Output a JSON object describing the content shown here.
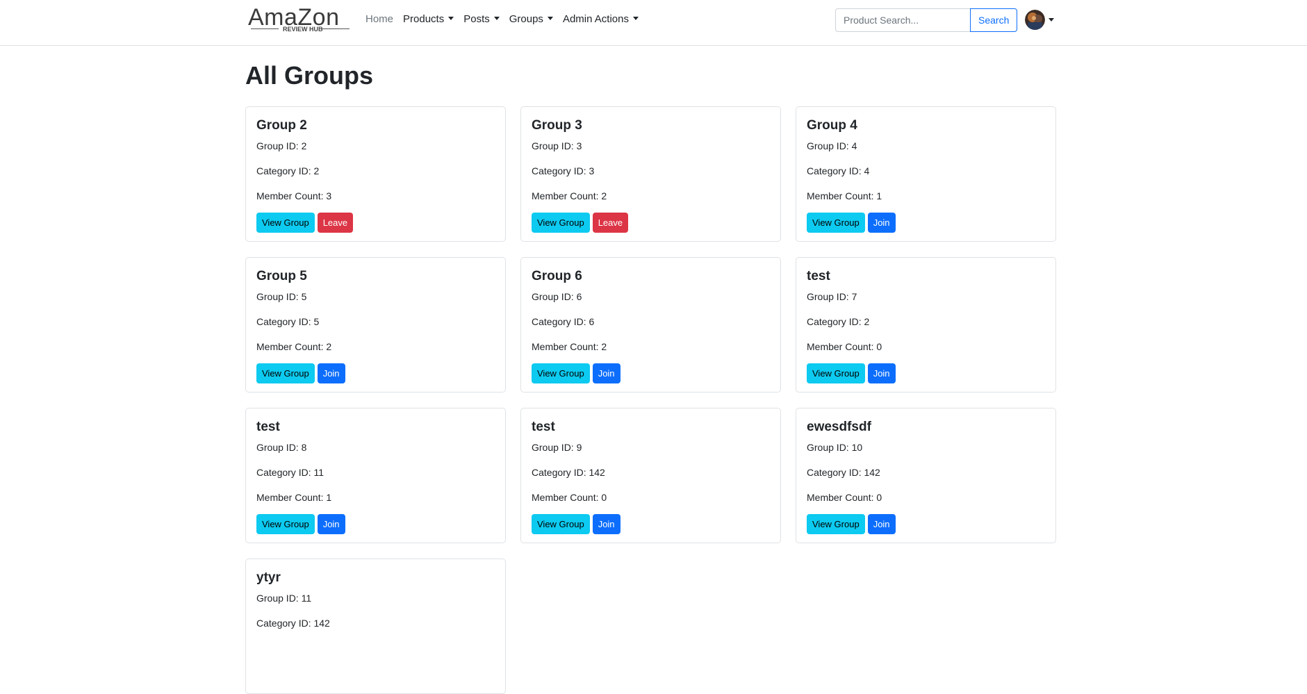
{
  "nav": {
    "logo": {
      "main": "AmaZon",
      "sub": "REVIEW HUB"
    },
    "links": [
      {
        "label": "Home",
        "dropdown": false,
        "muted": true
      },
      {
        "label": "Products",
        "dropdown": true,
        "muted": false
      },
      {
        "label": "Posts",
        "dropdown": true,
        "muted": false
      },
      {
        "label": "Groups",
        "dropdown": true,
        "muted": false
      },
      {
        "label": "Admin Actions",
        "dropdown": true,
        "muted": false
      }
    ],
    "search": {
      "placeholder": "Product Search...",
      "button": "Search"
    },
    "avatar_icon": "user-avatar-icon"
  },
  "page": {
    "title": "All Groups"
  },
  "labels": {
    "group_id": "Group ID: ",
    "category_id": "Category ID: ",
    "member_count": "Member Count: ",
    "view": "View Group",
    "join": "Join",
    "leave": "Leave"
  },
  "groups": [
    {
      "name": "Group 2",
      "group_id": "2",
      "category_id": "2",
      "member_count": "3",
      "action": "Leave"
    },
    {
      "name": "Group 3",
      "group_id": "3",
      "category_id": "3",
      "member_count": "2",
      "action": "Leave"
    },
    {
      "name": "Group 4",
      "group_id": "4",
      "category_id": "4",
      "member_count": "1",
      "action": "Join"
    },
    {
      "name": "Group 5",
      "group_id": "5",
      "category_id": "5",
      "member_count": "2",
      "action": "Join"
    },
    {
      "name": "Group 6",
      "group_id": "6",
      "category_id": "6",
      "member_count": "2",
      "action": "Join"
    },
    {
      "name": "test",
      "group_id": "7",
      "category_id": "2",
      "member_count": "0",
      "action": "Join"
    },
    {
      "name": "test",
      "group_id": "8",
      "category_id": "11",
      "member_count": "1",
      "action": "Join"
    },
    {
      "name": "test",
      "group_id": "9",
      "category_id": "142",
      "member_count": "0",
      "action": "Join"
    },
    {
      "name": "ewesdfsdf",
      "group_id": "10",
      "category_id": "142",
      "member_count": "0",
      "action": "Join"
    },
    {
      "name": "ytyr",
      "group_id": "11",
      "category_id": "142",
      "member_count": null,
      "action": null
    }
  ],
  "colors": {
    "view": "#0dcaf0",
    "join": "#0d6efd",
    "leave": "#dc3545"
  }
}
